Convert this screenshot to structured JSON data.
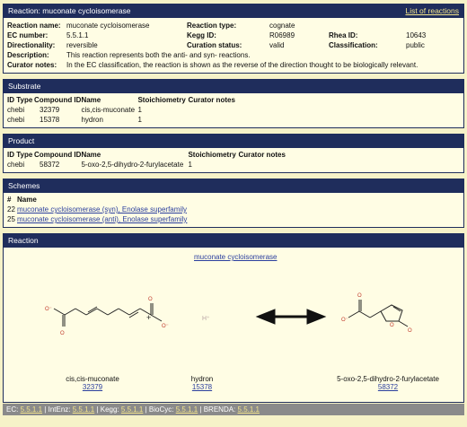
{
  "header": {
    "title": "Reaction: muconate cycloisomerase",
    "list_link": "List of reactions"
  },
  "info": {
    "reaction_name_label": "Reaction name:",
    "reaction_name": "muconate cycloisomerase",
    "reaction_type_label": "Reaction type:",
    "reaction_type": "cognate",
    "ec_label": "EC number:",
    "ec": "5.5.1.1",
    "kegg_label": "Kegg ID:",
    "kegg": "R06989",
    "rhea_label": "Rhea ID:",
    "rhea": "10643",
    "dir_label": "Directionality:",
    "dir": "reversible",
    "curation_label": "Curation status:",
    "curation": "valid",
    "class_label": "Classification:",
    "class": "public",
    "desc_label": "Description:",
    "desc": "This reaction represents both the anti- and syn- reactions.",
    "notes_label": "Curator notes:",
    "notes": "In the EC classification, the reaction is shown as the reverse of the direction thought to be biologically relevant."
  },
  "substrate": {
    "title": "Substrate",
    "headers": [
      "ID Type",
      "Compound ID",
      "Name",
      "Stoichiometry",
      "Curator notes"
    ],
    "rows": [
      [
        "chebi",
        "32379",
        "cis,cis-muconate",
        "1",
        ""
      ],
      [
        "chebi",
        "15378",
        "hydron",
        "1",
        ""
      ]
    ]
  },
  "product": {
    "title": "Product",
    "headers": [
      "ID Type",
      "Compound ID",
      "Name",
      "Stoichiometry",
      "Curator notes"
    ],
    "rows": [
      [
        "chebi",
        "58372",
        "5-oxo-2,5-dihydro-2-furylacetate",
        "1",
        ""
      ]
    ]
  },
  "schemes": {
    "title": "Schemes",
    "headers": [
      "#",
      "Name"
    ],
    "rows": [
      [
        "22",
        "muconate cycloisomerase (syn), Enolase superfamily"
      ],
      [
        "25",
        "muconate cycloisomerase (anti), Enolase superfamily"
      ]
    ]
  },
  "reaction": {
    "title": "Reaction",
    "link": "muconate cycloisomerase",
    "plus": "+",
    "hydron_label": "H⁺",
    "compounds": [
      {
        "name": "cis,cis-muconate",
        "id": "32379"
      },
      {
        "name": "hydron",
        "id": "15378"
      },
      {
        "name": "5-oxo-2,5-dihydro-2-furylacetate",
        "id": "58372"
      }
    ],
    "atom_o": "O",
    "atom_o_minus": "O⁻"
  },
  "footer": {
    "ec_label": "EC:",
    "ec_val": "5.5.1.1",
    "intenz_label": "IntEnz:",
    "intenz_val": "5.5.1.1",
    "kegg_label": "Kegg:",
    "kegg_val": "5.5.1.1",
    "biocyc_label": "BioCyc:",
    "biocyc_val": "5.5.1.1",
    "brenda_label": "BRENDA:",
    "brenda_val": "5.5.1.1",
    "sep": "|"
  }
}
